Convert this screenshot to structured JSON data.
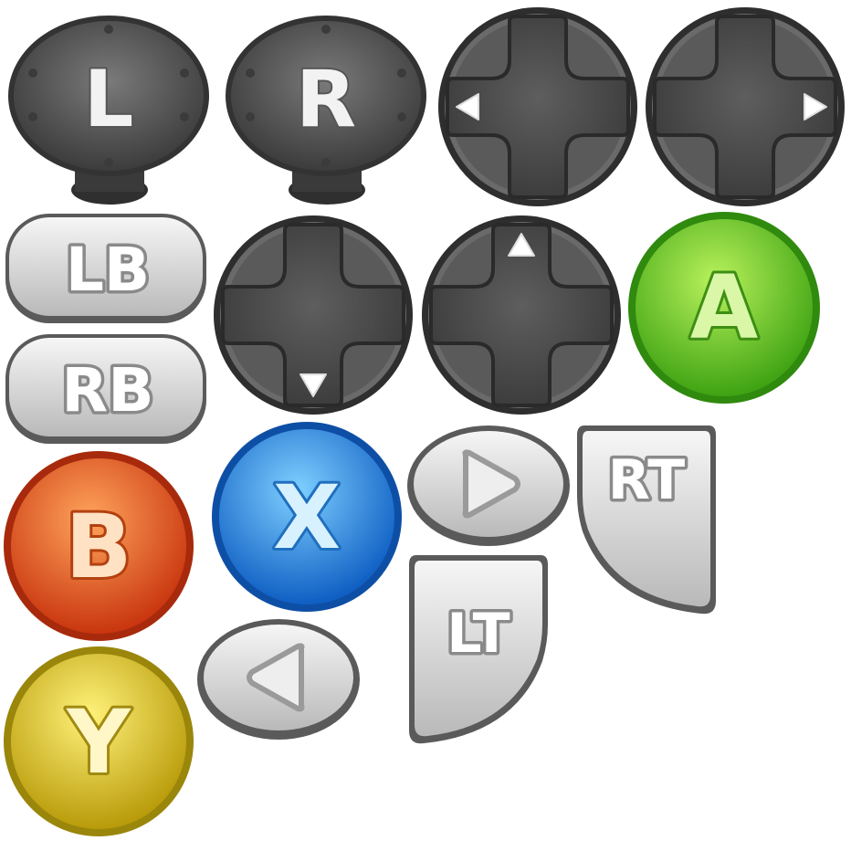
{
  "buttons": {
    "l": {
      "label": "L"
    },
    "r": {
      "label": "R"
    },
    "lb": {
      "label": "LB"
    },
    "rb": {
      "label": "RB"
    },
    "a": {
      "label": "A"
    },
    "b": {
      "label": "B"
    },
    "x": {
      "label": "X"
    },
    "y": {
      "label": "Y"
    },
    "lt": {
      "label": "LT"
    },
    "rt": {
      "label": "RT"
    }
  },
  "dpads": {
    "left": {
      "direction": "left"
    },
    "right": {
      "direction": "right"
    },
    "down": {
      "direction": "down"
    },
    "up": {
      "direction": "up"
    }
  },
  "colors": {
    "shoulder": "#5a5a5a",
    "dpad": "#505050",
    "silver": "#d4d4d4",
    "a_green": "#7ed82a",
    "b_orange": "#f06a28",
    "x_blue": "#2d9ae6",
    "y_yellow": "#e6d21e"
  }
}
